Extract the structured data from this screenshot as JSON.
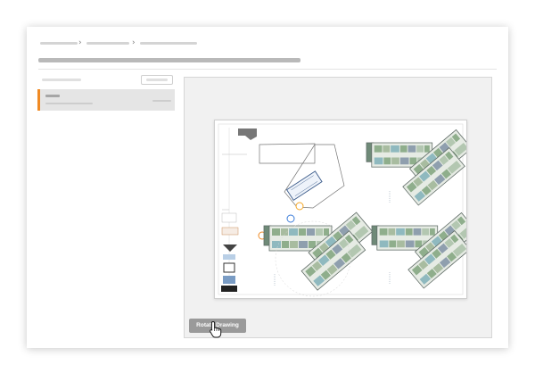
{
  "actions": {
    "rotate_label": "Rotate Drawing"
  },
  "icons": {
    "breadcrumb_separator": "chevron-right-icon",
    "cursor": "hand-pointer-icon"
  },
  "colors": {
    "accent": "#f08a24",
    "button_bg": "#9a9a9a",
    "plan_green": "#8fae8c",
    "plan_teal": "#8fb9bf",
    "plan_slate": "#8f9fae"
  }
}
